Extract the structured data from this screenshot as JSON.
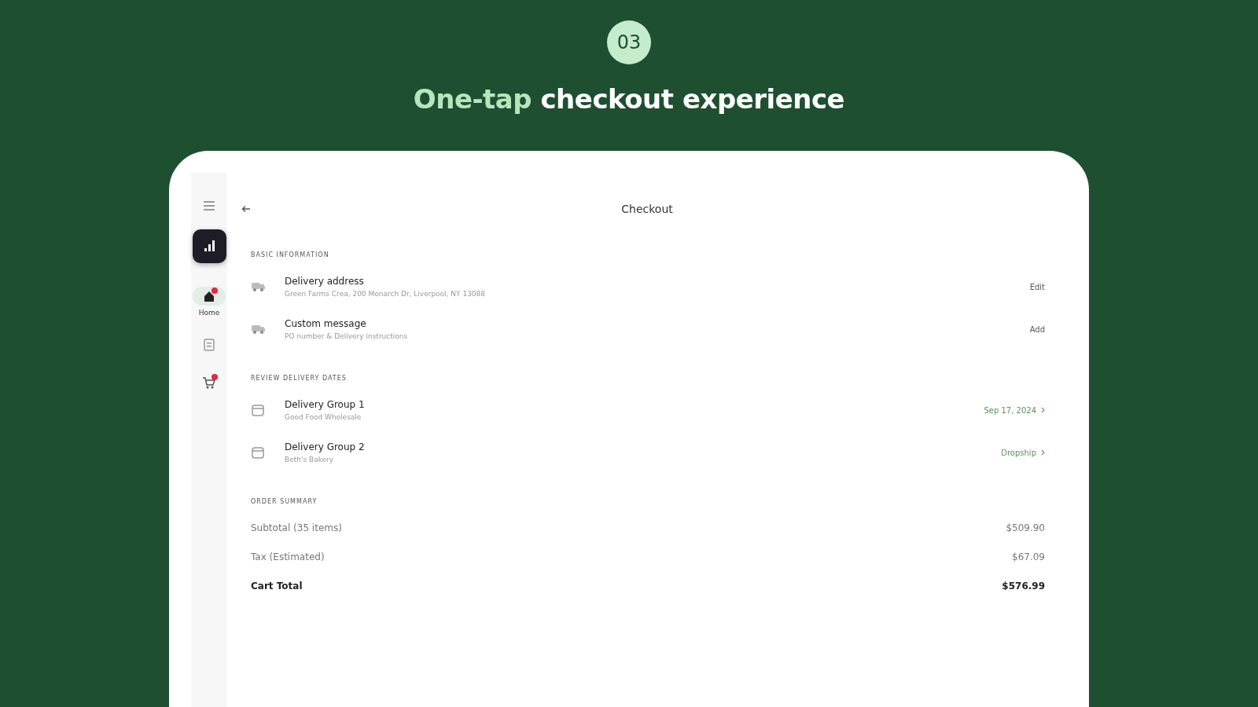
{
  "badge": "03",
  "headline": {
    "highlight": "One-tap",
    "rest": "checkout experience"
  },
  "sidebar": {
    "items": [
      {
        "kind": "home",
        "label": "Home",
        "selected": true,
        "notification": true
      },
      {
        "kind": "orders",
        "selected": false,
        "notification": false
      },
      {
        "kind": "cart",
        "selected": false,
        "notification": true
      }
    ]
  },
  "screen": {
    "title": "Checkout",
    "sections": [
      {
        "heading": "BASIC INFORMATION",
        "rows": [
          {
            "title": "Delivery address",
            "subtitle": "Green Farms Crea, 200 Monarch Dr, Liverpool, NY 13088",
            "action": "Edit",
            "kind": "plain"
          },
          {
            "title": "Custom message",
            "subtitle": "PO number & Delivery instructions",
            "action": "Add",
            "kind": "plain"
          }
        ]
      },
      {
        "heading": "REVIEW DELIVERY DATES",
        "rows": [
          {
            "title": "Delivery Group 1",
            "subtitle": "Good Food Wholesale",
            "action": "Sep 17, 2024",
            "kind": "chevron"
          },
          {
            "title": "Delivery Group 2",
            "subtitle": "Beth's Bakery",
            "action": "Dropship",
            "kind": "chevron"
          }
        ]
      }
    ],
    "summary": {
      "heading": "ORDER SUMMARY",
      "rows": [
        {
          "label": "Subtotal (35 items)",
          "value": "$509.90",
          "total": false
        },
        {
          "label": "Tax (Estimated)",
          "value": "$67.09",
          "total": false
        },
        {
          "label": "Cart Total",
          "value": "$576.99",
          "total": true
        }
      ]
    }
  }
}
